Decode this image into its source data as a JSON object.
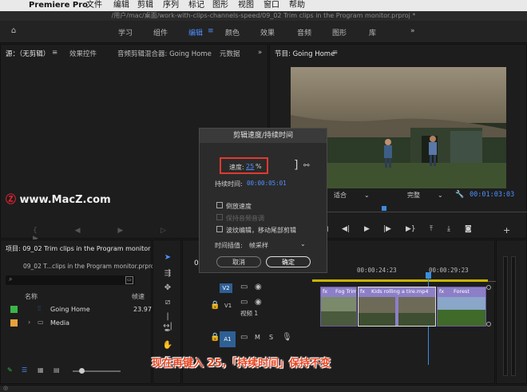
{
  "menubar": {
    "app": "Premiere Pro",
    "items": [
      "文件",
      "编辑",
      "剪辑",
      "序列",
      "标记",
      "图形",
      "视图",
      "窗口",
      "帮助"
    ]
  },
  "pathbar": {
    "text": "/用户/mac/桌面/work-with-clips-channels-speed/09_02 Trim clips in the Program monitor.prproj *"
  },
  "workspaces": [
    "学习",
    "组件",
    "编辑",
    "颜色",
    "效果",
    "音频",
    "图形",
    "库"
  ],
  "workspace_active": "编辑",
  "source_panel": {
    "tabs": [
      "源：（无剪辑）",
      "效果控件",
      "音频剪辑混合器: Going Home",
      "元数据"
    ],
    "watermark": "www.MacZ.com"
  },
  "program_panel": {
    "tab": "节目: Going Home",
    "fit": "适合",
    "quality": "完整",
    "timecode": "00:01:03:03"
  },
  "dialog": {
    "title": "剪辑速度/持续时间",
    "speed_label": "速度:",
    "speed_value": "25",
    "speed_unit": "%",
    "duration_label": "持续时间:",
    "duration_value": "00:00:05:01",
    "options": [
      {
        "label": "倒放速度",
        "enabled": true,
        "checked": false
      },
      {
        "label": "保持音频音调",
        "enabled": false,
        "checked": false
      },
      {
        "label": "波纹编辑，移动尾部剪辑",
        "enabled": true,
        "checked": false
      }
    ],
    "interp_label": "时间插值:",
    "interp_value": "帧采样",
    "cancel": "取消",
    "ok": "确定"
  },
  "project_panel": {
    "tab": "项目: 09_02 Trim clips in the Program monitor",
    "file": "09_02 T...clips in the Program monitor.prproj",
    "col_name": "名称",
    "col_rate": "帧速",
    "items": [
      {
        "name": "Going Home",
        "rate": "23.97",
        "color": "#3bb54a"
      },
      {
        "name": "Media",
        "rate": "",
        "color": "#e8a23c"
      }
    ]
  },
  "timeline": {
    "seq_tab": "0",
    "times": [
      "00:00:24:23",
      "00:00:29:23"
    ],
    "tracks": [
      {
        "label": "V2"
      },
      {
        "label": "V1",
        "name": "视频 1"
      },
      {
        "label": "A1"
      }
    ],
    "clips": [
      {
        "label": "Fog Trim"
      },
      {
        "label": "Kids rolling a tire.mp4"
      },
      {
        "label": "Forest"
      }
    ]
  },
  "caption": "现在再键入 25，「持续时间」保持不变",
  "colors": {
    "accent": "#4d90ff",
    "highlight": "#e03a2f",
    "caption": "#e8431f",
    "playhead": "#3a8dde"
  }
}
